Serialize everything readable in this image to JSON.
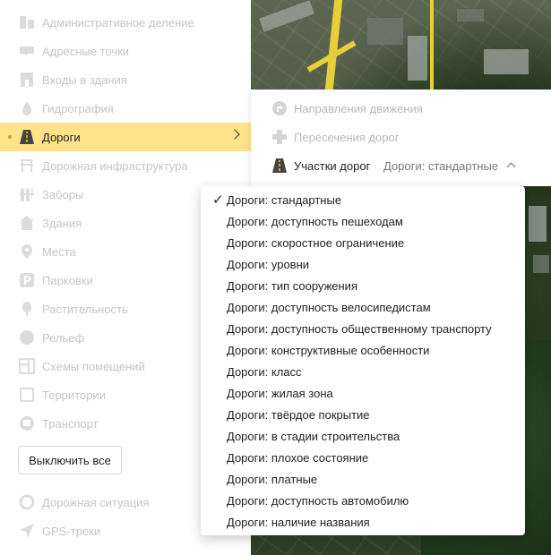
{
  "sidebar": {
    "items": [
      {
        "label": "Административное деление",
        "icon": "admin-division-icon"
      },
      {
        "label": "Адресные точки",
        "icon": "address-point-icon"
      },
      {
        "label": "Входы в здания",
        "icon": "building-entrance-icon"
      },
      {
        "label": "Гидрография",
        "icon": "water-drop-icon"
      },
      {
        "label": "Дороги",
        "icon": "road-icon",
        "active": true
      },
      {
        "label": "Дорожная инфраструктура",
        "icon": "road-infrastructure-icon"
      },
      {
        "label": "Заборы",
        "icon": "fence-icon"
      },
      {
        "label": "Здания",
        "icon": "building-icon"
      },
      {
        "label": "Места",
        "icon": "place-pin-icon"
      },
      {
        "label": "Парковки",
        "icon": "parking-icon"
      },
      {
        "label": "Растительность",
        "icon": "tree-icon"
      },
      {
        "label": "Рельеф",
        "icon": "relief-icon"
      },
      {
        "label": "Схемы помещений",
        "icon": "floor-plan-icon"
      },
      {
        "label": "Территории",
        "icon": "territory-icon"
      },
      {
        "label": "Транспорт",
        "icon": "transport-icon"
      }
    ],
    "disable_all_label": "Выключить все",
    "extra_items": [
      {
        "label": "Дорожная ситуация",
        "icon": "traffic-icon"
      },
      {
        "label": "GPS-треки",
        "icon": "gps-arrow-icon"
      }
    ]
  },
  "submenu": {
    "items": [
      {
        "label": "Направления движения",
        "icon": "direction-icon"
      },
      {
        "label": "Пересечения дорог",
        "icon": "crossing-icon"
      },
      {
        "label": "Участки дорог",
        "icon": "road-segment-icon",
        "value": "Дороги: стандартные"
      }
    ]
  },
  "dropdown": {
    "selected_index": 0,
    "options": [
      "Дороги: стандартные",
      "Дороги: доступность пешеходам",
      "Дороги: скоростное ограничение",
      "Дороги: уровни",
      "Дороги: тип сооружения",
      "Дороги: доступность велосипедистам",
      "Дороги: доступность общественному транспорту",
      "Дороги: конструктивные особенности",
      "Дороги: класс",
      "Дороги: жилая зона",
      "Дороги: твёрдое покрытие",
      "Дороги: в стадии строительства",
      "Дороги: плохое состояние",
      "Дороги: платные",
      "Дороги: доступность автомобилю",
      "Дороги: наличие названия"
    ]
  },
  "colors": {
    "active_bg": "#ffe28a",
    "muted_text": "#c5c5c5",
    "road_yellow": "#e8cf3a"
  }
}
